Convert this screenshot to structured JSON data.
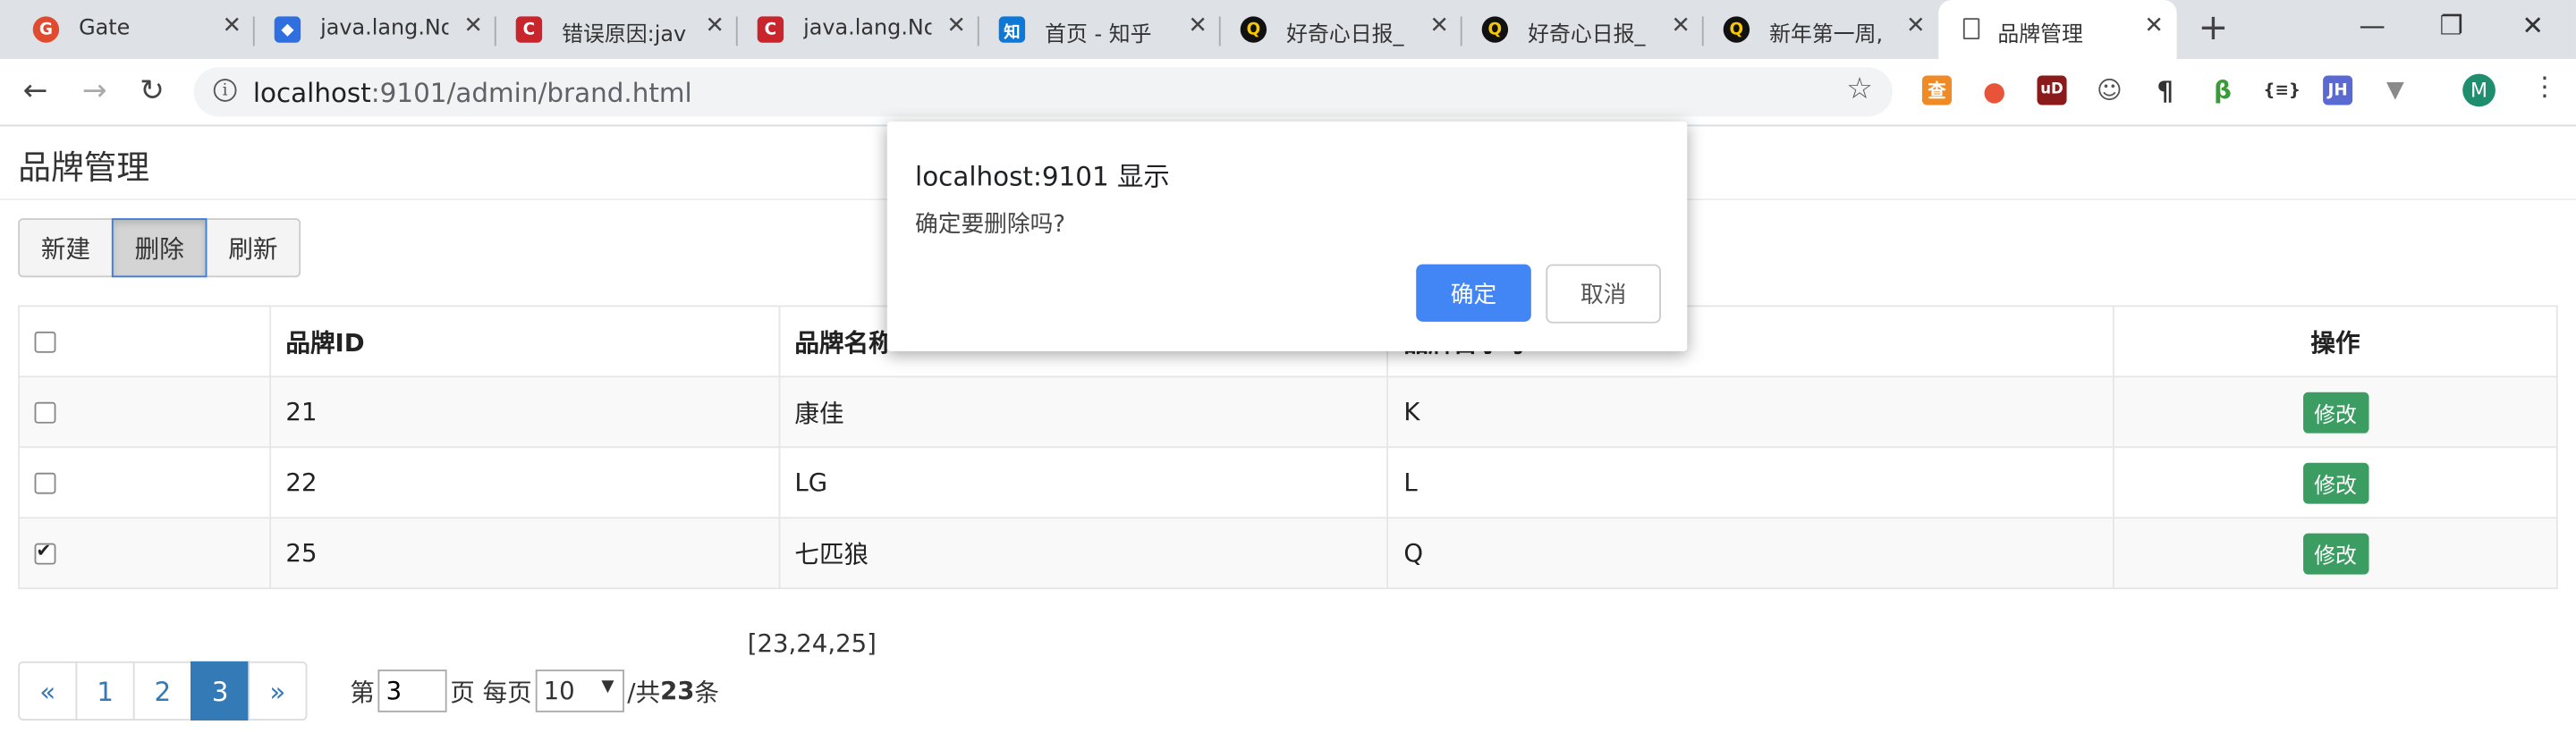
{
  "browser": {
    "tabs": [
      {
        "title": "Gate",
        "favicon": "gate-icon",
        "color": "#e04a2f",
        "glyph": "G"
      },
      {
        "title": "java.lang.No",
        "favicon": "baidu-paw-icon",
        "color": "#2f6fe0",
        "glyph": "🐾"
      },
      {
        "title": "错误原因:jav",
        "favicon": "csdn-icon",
        "color": "#c9252c",
        "glyph": "C"
      },
      {
        "title": "java.lang.No",
        "favicon": "csdn-icon",
        "color": "#c9252c",
        "glyph": "C"
      },
      {
        "title": "首页 - 知乎",
        "favicon": "zhihu-icon",
        "color": "#0e78d6",
        "glyph": "知"
      },
      {
        "title": "好奇心日报_",
        "favicon": "qdaily-icon",
        "color": "#111111",
        "glyph": "Q"
      },
      {
        "title": "好奇心日报_",
        "favicon": "qdaily-icon",
        "color": "#111111",
        "glyph": "Q"
      },
      {
        "title": "新年第一周,",
        "favicon": "qdaily-icon",
        "color": "#111111",
        "glyph": "Q"
      },
      {
        "title": "品牌管理",
        "favicon": "page-icon",
        "color": "#ffffff",
        "glyph": "",
        "active": true
      }
    ],
    "url_host": "localhost",
    "url_path": ":9101/admin/brand.html",
    "avatar_letter": "M",
    "extensions": [
      {
        "name": "ext-orange-icon",
        "color": "#f08a24",
        "glyph": "查"
      },
      {
        "name": "ext-location-icon",
        "color": "#e8543a",
        "glyph": "●"
      },
      {
        "name": "ublock-icon",
        "color": "#8b1a1a",
        "glyph": "uD"
      },
      {
        "name": "ext-mascot-icon",
        "color": "#6b6b6b",
        "glyph": "☺"
      },
      {
        "name": "pilcrow-icon",
        "color": "#333333",
        "glyph": "¶"
      },
      {
        "name": "ext-green-icon",
        "color": "#3a9b3a",
        "glyph": "β"
      },
      {
        "name": "json-icon",
        "color": "#333333",
        "glyph": "{≡}"
      },
      {
        "name": "jh-icon",
        "color": "#5b6ad0",
        "glyph": "JH"
      },
      {
        "name": "vue-devtools-icon",
        "color": "#8a8a8a",
        "glyph": "▼"
      }
    ]
  },
  "page": {
    "title": "品牌管理",
    "buttons": {
      "new": "新建",
      "delete": "删除",
      "refresh": "刷新"
    },
    "table": {
      "headers": {
        "id": "品牌ID",
        "name": "品牌名称",
        "letter": "品牌首字母",
        "ops": "操作"
      },
      "rows": [
        {
          "id": "21",
          "name": "康佳",
          "letter": "K",
          "checked": false,
          "edit": "修改"
        },
        {
          "id": "22",
          "name": "LG",
          "letter": "L",
          "checked": false,
          "edit": "修改"
        },
        {
          "id": "25",
          "name": "七匹狼",
          "letter": "Q",
          "checked": true,
          "edit": "修改"
        }
      ]
    },
    "selected_ids": "[23,24,25]",
    "pagination": {
      "prev": "«",
      "next": "»",
      "pages": [
        "1",
        "2",
        "3"
      ],
      "current": "3",
      "label_page_prefix": "第",
      "page_input": "3",
      "label_page_suffix": "页 每页",
      "page_size": "10",
      "label_total_prefix": "/共",
      "total": "23",
      "label_total_suffix": "条"
    }
  },
  "dialog": {
    "title": "localhost:9101 显示",
    "message": "确定要删除吗?",
    "ok": "确定",
    "cancel": "取消"
  }
}
